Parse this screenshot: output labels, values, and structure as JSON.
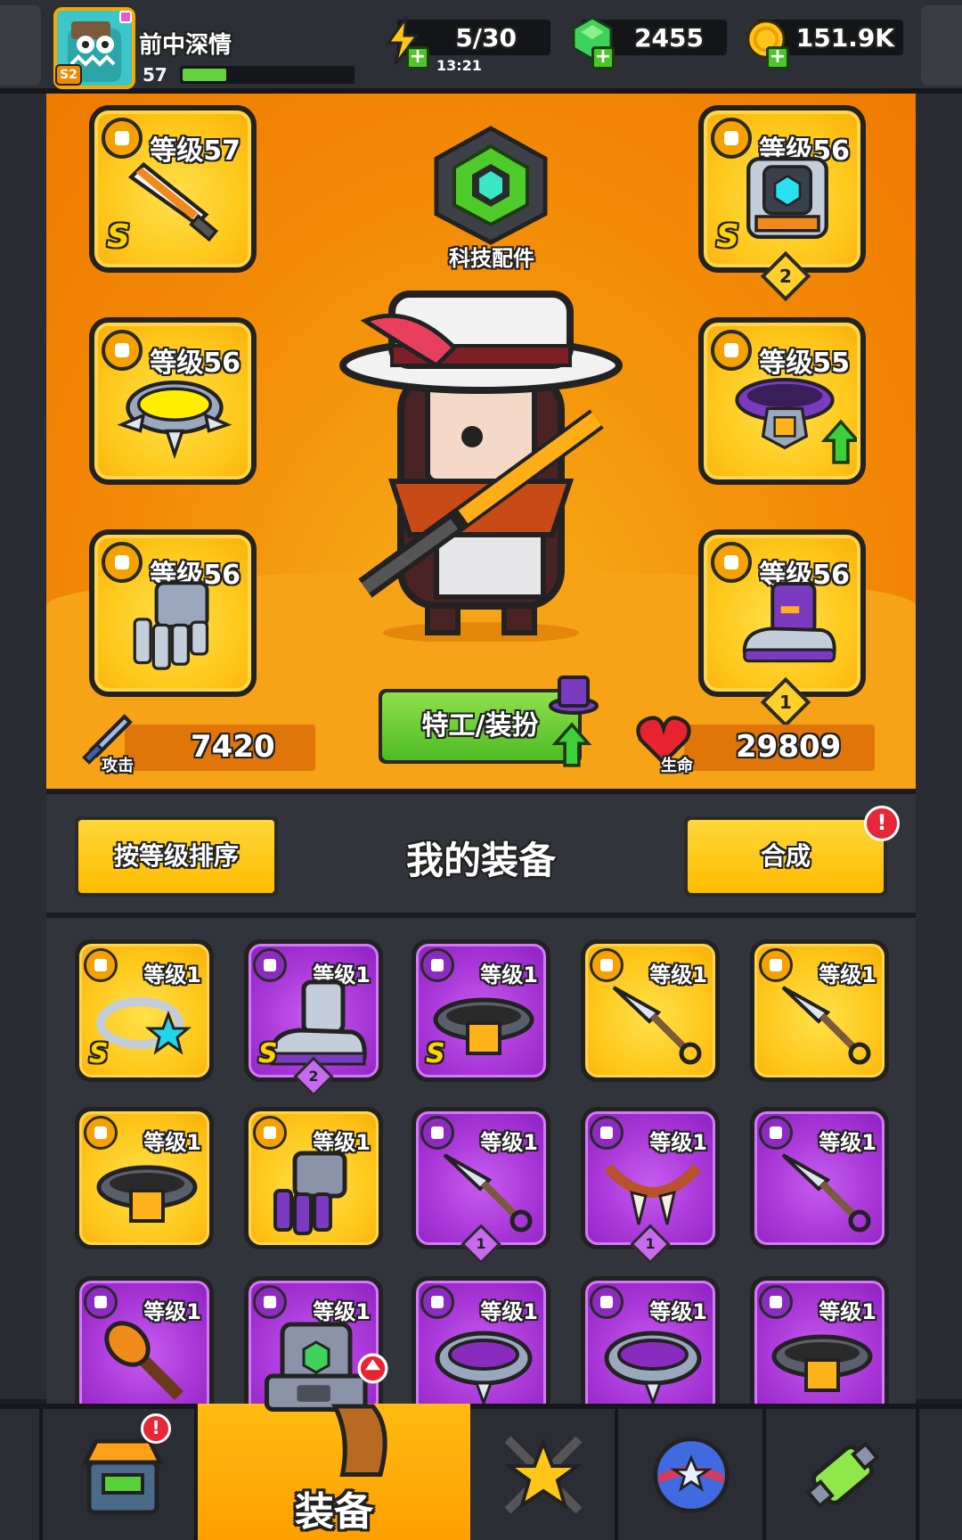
{
  "player": {
    "name": "前中深情",
    "level": "57",
    "season_badge": "S2",
    "xp_fraction": 0.26
  },
  "resources": {
    "energy": "5/30",
    "energy_timer": "13:21",
    "gems": "2455",
    "coins": "151.9K"
  },
  "hero": {
    "tech_label": "科技配件",
    "outfit_button": "特工/装扮",
    "attack_label": "攻击",
    "attack_value": "7420",
    "health_label": "生命",
    "health_value": "29809"
  },
  "equipped": {
    "weapon": {
      "level": "等级57",
      "rank": "S",
      "icon": "sword-icon"
    },
    "armor": {
      "level": "等级56",
      "rank": "S",
      "badge": "2",
      "icon": "armor-icon"
    },
    "necklace": {
      "level": "等级56",
      "icon": "spiked-collar-icon"
    },
    "belt": {
      "level": "等级55",
      "icon": "belt-icon",
      "upgrade": true
    },
    "gloves": {
      "level": "等级56",
      "icon": "gauntlet-icon"
    },
    "boots": {
      "level": "等级56",
      "badge": "1",
      "icon": "boot-icon"
    }
  },
  "gear_panel": {
    "sort_button": "按等级排序",
    "title": "我的装备",
    "merge_button": "合成",
    "merge_alert": "!"
  },
  "inventory": [
    {
      "level": "等级1",
      "color": "yellow",
      "rank": "S",
      "icon": "star-ring-icon"
    },
    {
      "level": "等级1",
      "color": "purple",
      "rank": "S",
      "badge": "2",
      "icon": "boot-icon"
    },
    {
      "level": "等级1",
      "color": "purple",
      "rank": "S",
      "icon": "belt-icon"
    },
    {
      "level": "等级1",
      "color": "yellow",
      "icon": "kunai-icon"
    },
    {
      "level": "等级1",
      "color": "yellow",
      "icon": "kunai-icon"
    },
    {
      "level": "等级1",
      "color": "yellow",
      "icon": "belt-icon"
    },
    {
      "level": "等级1",
      "color": "yellow",
      "icon": "gauntlet-icon"
    },
    {
      "level": "等级1",
      "color": "purple",
      "badge": "1",
      "icon": "kunai-icon"
    },
    {
      "level": "等级1",
      "color": "purple",
      "badge": "1",
      "icon": "fang-necklace-icon"
    },
    {
      "level": "等级1",
      "color": "purple",
      "icon": "kunai-icon"
    },
    {
      "level": "等级1",
      "color": "purple",
      "icon": "mace-icon"
    },
    {
      "level": "等级1",
      "color": "purple",
      "icon": "armor-icon"
    },
    {
      "level": "等级1",
      "color": "purple",
      "icon": "spiked-collar-icon"
    },
    {
      "level": "等级1",
      "color": "purple",
      "icon": "spiked-collar-icon"
    },
    {
      "level": "等级1",
      "color": "purple",
      "icon": "belt-icon"
    }
  ],
  "nav": {
    "shop_alert": "!",
    "equip_label": "装备"
  },
  "colors": {
    "accent_orange": "#f38a06",
    "gold": "#ffc81c",
    "epic_purple": "#a735d6",
    "green_button": "#4fbb24"
  }
}
